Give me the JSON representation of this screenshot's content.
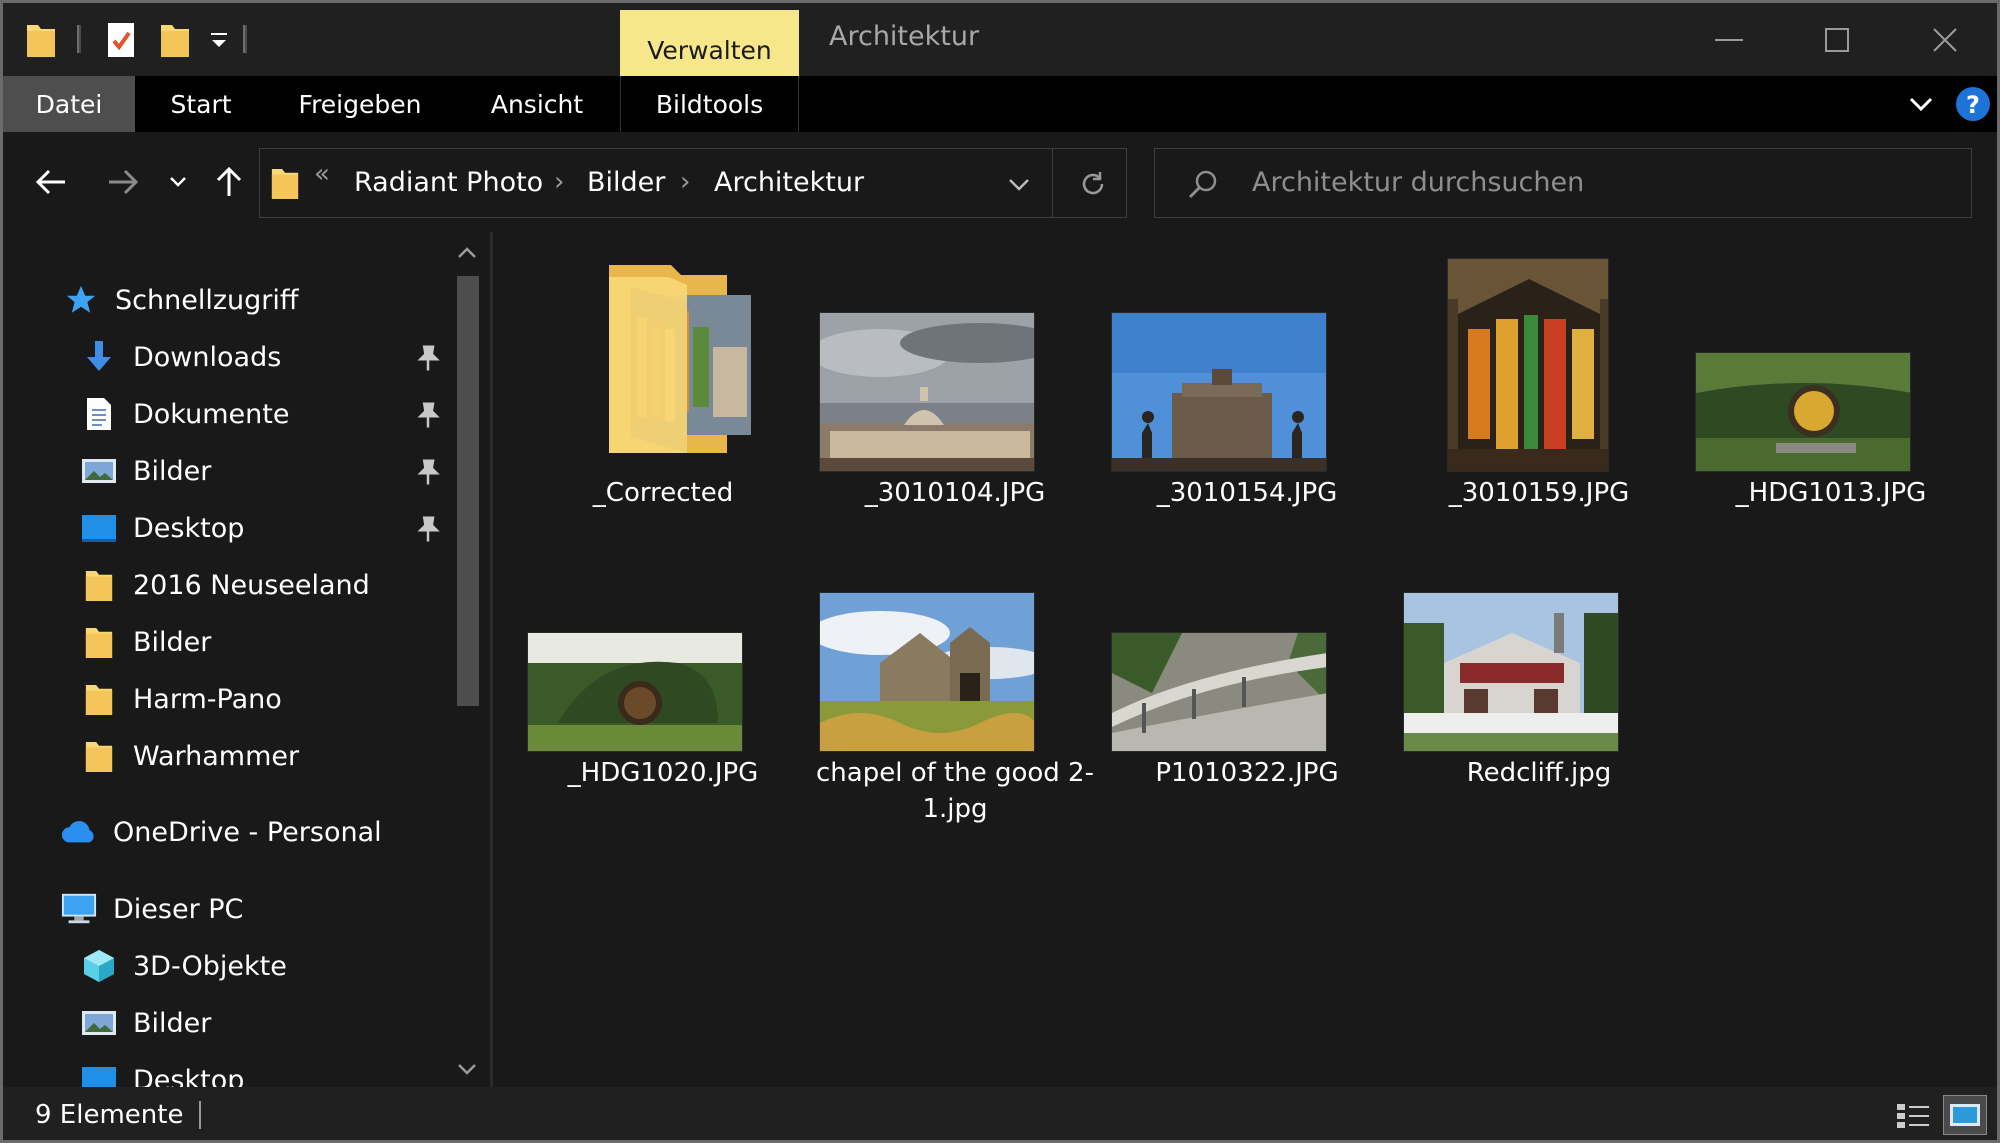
{
  "window": {
    "title": "Architektur",
    "context_tab": "Verwalten",
    "accent_context": "#f6e88a"
  },
  "ribbon": {
    "tabs": [
      "Datei",
      "Start",
      "Freigeben",
      "Ansicht",
      "Bildtools"
    ]
  },
  "address": {
    "overflow": "«",
    "crumbs": [
      "Radiant Photo",
      "Bilder",
      "Architektur"
    ]
  },
  "search": {
    "placeholder": "Architektur durchsuchen"
  },
  "nav": {
    "quick_access": "Schnellzugriff",
    "items": [
      {
        "label": "Downloads",
        "icon": "download-icon",
        "pinned": true
      },
      {
        "label": "Dokumente",
        "icon": "document-icon",
        "pinned": true
      },
      {
        "label": "Bilder",
        "icon": "pictures-icon",
        "pinned": true
      },
      {
        "label": "Desktop",
        "icon": "desktop-icon",
        "pinned": true
      },
      {
        "label": "2016 Neuseeland",
        "icon": "folder-icon",
        "pinned": false
      },
      {
        "label": "Bilder",
        "icon": "folder-icon",
        "pinned": false
      },
      {
        "label": "Harm-Pano",
        "icon": "folder-icon",
        "pinned": false
      },
      {
        "label": "Warhammer",
        "icon": "folder-icon",
        "pinned": false
      }
    ],
    "onedrive": "OneDrive - Personal",
    "this_pc": "Dieser PC",
    "pc_items": [
      {
        "label": "3D-Objekte",
        "icon": "3d-objects-icon"
      },
      {
        "label": "Bilder",
        "icon": "pictures-icon"
      },
      {
        "label": "Desktop",
        "icon": "desktop-icon"
      }
    ]
  },
  "files": [
    {
      "name": "_Corrected",
      "kind": "folder"
    },
    {
      "name": "_3010104.JPG",
      "kind": "image"
    },
    {
      "name": "_3010154.JPG",
      "kind": "image"
    },
    {
      "name": "_3010159.JPG",
      "kind": "image"
    },
    {
      "name": "_HDG1013.JPG",
      "kind": "image"
    },
    {
      "name": "_HDG1020.JPG",
      "kind": "image"
    },
    {
      "name": "chapel of the good 2-1.jpg",
      "kind": "image"
    },
    {
      "name": "P1010322.JPG",
      "kind": "image"
    },
    {
      "name": "Redcliff.jpg",
      "kind": "image"
    }
  ],
  "status": {
    "count_text": "9 Elemente"
  },
  "colors": {
    "background": "#191919",
    "ribbon_bg": "#000000",
    "help_blue": "#1e73d8",
    "folder_yellow": "#f8d775"
  }
}
